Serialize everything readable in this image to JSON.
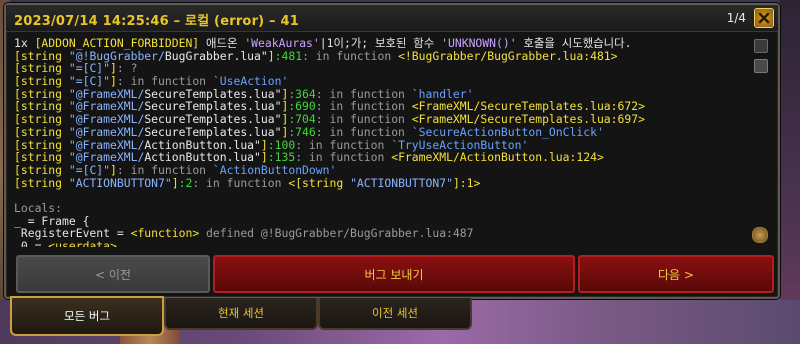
{
  "window": {
    "title": "2023/07/14 14:25:46 – 로컬 (error) – 41",
    "page_counter": "1/4",
    "close_icon": "close-icon"
  },
  "log_lines": [
    [
      {
        "t": "1x ",
        "c": "white"
      },
      {
        "t": "[ADDON_ACTION_FORBIDDEN]",
        "c": "yellow"
      },
      {
        "t": " 애드온 ",
        "c": "white"
      },
      {
        "t": "'WeakAuras'",
        "c": "purple"
      },
      {
        "t": "|1이;가; 보호된 함수 ",
        "c": "white"
      },
      {
        "t": "'UNKNOWN()'",
        "c": "purple"
      },
      {
        "t": " 호출을 시도했습니다.",
        "c": "white"
      }
    ],
    [
      {
        "t": "[string ",
        "c": "yellow"
      },
      {
        "t": "\"@!BugGrabber/",
        "c": "lblue"
      },
      {
        "t": "BugGrabber.lua\"",
        "c": "fn"
      },
      {
        "t": "]",
        "c": "yellow"
      },
      {
        "t": ":481",
        "c": "green"
      },
      {
        "t": ": in function ",
        "c": "grey"
      },
      {
        "t": "<!BugGrabber/BugGrabber.lua:481>",
        "c": "yellow"
      }
    ],
    [
      {
        "t": "[string ",
        "c": "yellow"
      },
      {
        "t": "\"=[C]\"",
        "c": "lblue"
      },
      {
        "t": "]",
        "c": "yellow"
      },
      {
        "t": ": ?",
        "c": "grey"
      }
    ],
    [
      {
        "t": "[string ",
        "c": "yellow"
      },
      {
        "t": "\"=[C]\"",
        "c": "lblue"
      },
      {
        "t": "]",
        "c": "yellow"
      },
      {
        "t": ": in function ",
        "c": "grey"
      },
      {
        "t": "`UseAction'",
        "c": "blue"
      }
    ],
    [
      {
        "t": "[string ",
        "c": "yellow"
      },
      {
        "t": "\"@FrameXML/",
        "c": "lblue"
      },
      {
        "t": "SecureTemplates.lua\"",
        "c": "fn"
      },
      {
        "t": "]",
        "c": "yellow"
      },
      {
        "t": ":364",
        "c": "green"
      },
      {
        "t": ": in function ",
        "c": "grey"
      },
      {
        "t": "`handler'",
        "c": "blue"
      }
    ],
    [
      {
        "t": "[string ",
        "c": "yellow"
      },
      {
        "t": "\"@FrameXML/",
        "c": "lblue"
      },
      {
        "t": "SecureTemplates.lua\"",
        "c": "fn"
      },
      {
        "t": "]",
        "c": "yellow"
      },
      {
        "t": ":690",
        "c": "green"
      },
      {
        "t": ": in function ",
        "c": "grey"
      },
      {
        "t": "<FrameXML/SecureTemplates.lua:672>",
        "c": "yellow"
      }
    ],
    [
      {
        "t": "[string ",
        "c": "yellow"
      },
      {
        "t": "\"@FrameXML/",
        "c": "lblue"
      },
      {
        "t": "SecureTemplates.lua\"",
        "c": "fn"
      },
      {
        "t": "]",
        "c": "yellow"
      },
      {
        "t": ":704",
        "c": "green"
      },
      {
        "t": ": in function ",
        "c": "grey"
      },
      {
        "t": "<FrameXML/SecureTemplates.lua:697>",
        "c": "yellow"
      }
    ],
    [
      {
        "t": "[string ",
        "c": "yellow"
      },
      {
        "t": "\"@FrameXML/",
        "c": "lblue"
      },
      {
        "t": "SecureTemplates.lua\"",
        "c": "fn"
      },
      {
        "t": "]",
        "c": "yellow"
      },
      {
        "t": ":746",
        "c": "green"
      },
      {
        "t": ": in function ",
        "c": "grey"
      },
      {
        "t": "`SecureActionButton_OnClick'",
        "c": "blue"
      }
    ],
    [
      {
        "t": "[string ",
        "c": "yellow"
      },
      {
        "t": "\"@FrameXML/",
        "c": "lblue"
      },
      {
        "t": "ActionButton.lua\"",
        "c": "fn"
      },
      {
        "t": "]",
        "c": "yellow"
      },
      {
        "t": ":100",
        "c": "green"
      },
      {
        "t": ": in function ",
        "c": "grey"
      },
      {
        "t": "`TryUseActionButton'",
        "c": "blue"
      }
    ],
    [
      {
        "t": "[string ",
        "c": "yellow"
      },
      {
        "t": "\"@FrameXML/",
        "c": "lblue"
      },
      {
        "t": "ActionButton.lua\"",
        "c": "fn"
      },
      {
        "t": "]",
        "c": "yellow"
      },
      {
        "t": ":135",
        "c": "green"
      },
      {
        "t": ": in function ",
        "c": "grey"
      },
      {
        "t": "<FrameXML/ActionButton.lua:124>",
        "c": "yellow"
      }
    ],
    [
      {
        "t": "[string ",
        "c": "yellow"
      },
      {
        "t": "\"=[C]\"",
        "c": "lblue"
      },
      {
        "t": "]",
        "c": "yellow"
      },
      {
        "t": ": in function ",
        "c": "grey"
      },
      {
        "t": "`ActionButtonDown'",
        "c": "blue"
      }
    ],
    [
      {
        "t": "[string ",
        "c": "yellow"
      },
      {
        "t": "\"ACTIONBUTTON7\"",
        "c": "lblue"
      },
      {
        "t": "]",
        "c": "yellow"
      },
      {
        "t": ":2",
        "c": "green"
      },
      {
        "t": ": in function ",
        "c": "grey"
      },
      {
        "t": "<[string ",
        "c": "yellow"
      },
      {
        "t": "\"ACTIONBUTTON7\"",
        "c": "lblue"
      },
      {
        "t": "]:1>",
        "c": "yellow"
      }
    ],
    [],
    [
      {
        "t": "Locals:",
        "c": "grey"
      }
    ],
    [
      {
        "t": "_ = Frame {",
        "c": "white"
      }
    ],
    [
      {
        "t": " RegisterEvent = ",
        "c": "white"
      },
      {
        "t": "<function>",
        "c": "yellow"
      },
      {
        "t": " defined @!BugGrabber/BugGrabber.lua:487",
        "c": "grey"
      }
    ],
    [
      {
        "t": " 0 = ",
        "c": "white"
      },
      {
        "t": "<userdata>",
        "c": "yellow"
      }
    ]
  ],
  "buttons": {
    "prev_label": "< 이전",
    "send_label": "버그 보내기",
    "next_label": "다음 >"
  },
  "tabs": {
    "all_label": "모든 버그",
    "current_label": "현재 세션",
    "previous_label": "이전 세션"
  }
}
